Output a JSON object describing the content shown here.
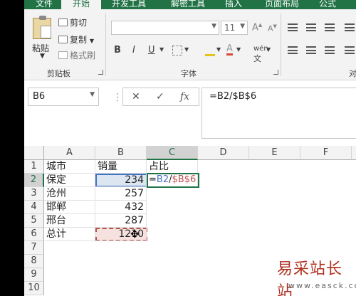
{
  "tabs": [
    "文件",
    "开始",
    "开发工具",
    "解密工具",
    "插入",
    "页面布局",
    "公式"
  ],
  "clipboard": {
    "paste": "粘贴",
    "cut": "剪切",
    "copy": "复制",
    "painter": "格式刷",
    "group": "剪贴板"
  },
  "font": {
    "size": "11",
    "bold": "B",
    "italic": "I",
    "underline": "U",
    "wen": "wén",
    "group": "字体",
    "increase": "A",
    "decrease": "A"
  },
  "align": {
    "group": "对"
  },
  "namebox": "B6",
  "formula_buttons": {
    "cancel": "✕",
    "enter": "✓",
    "fx": "fx"
  },
  "formula": "=B2/$B$6",
  "columns": [
    "A",
    "B",
    "C",
    "D",
    "E",
    "F"
  ],
  "rows": [
    "1",
    "2",
    "3",
    "4",
    "5",
    "6",
    "7",
    "8",
    "9",
    "10"
  ],
  "cells": {
    "A1": "城市",
    "B1": "销量",
    "C1": "占比",
    "A2": "保定",
    "B2": "234",
    "A3": "沧州",
    "B3": "257",
    "A4": "邯郸",
    "B4": "432",
    "A5": "邢台",
    "B5": "287",
    "A6": "总计",
    "B6": "1210"
  },
  "edit_formula": {
    "eq": "=",
    "ref1": "B2",
    "slash": "/",
    "ref2": "$B$6"
  },
  "watermark": {
    "text": "易采站长站",
    "url": "www.easck.com"
  },
  "colors": {
    "accent": "#217346",
    "ref_blue": "#4472c4",
    "ref_red": "#c0504d"
  }
}
